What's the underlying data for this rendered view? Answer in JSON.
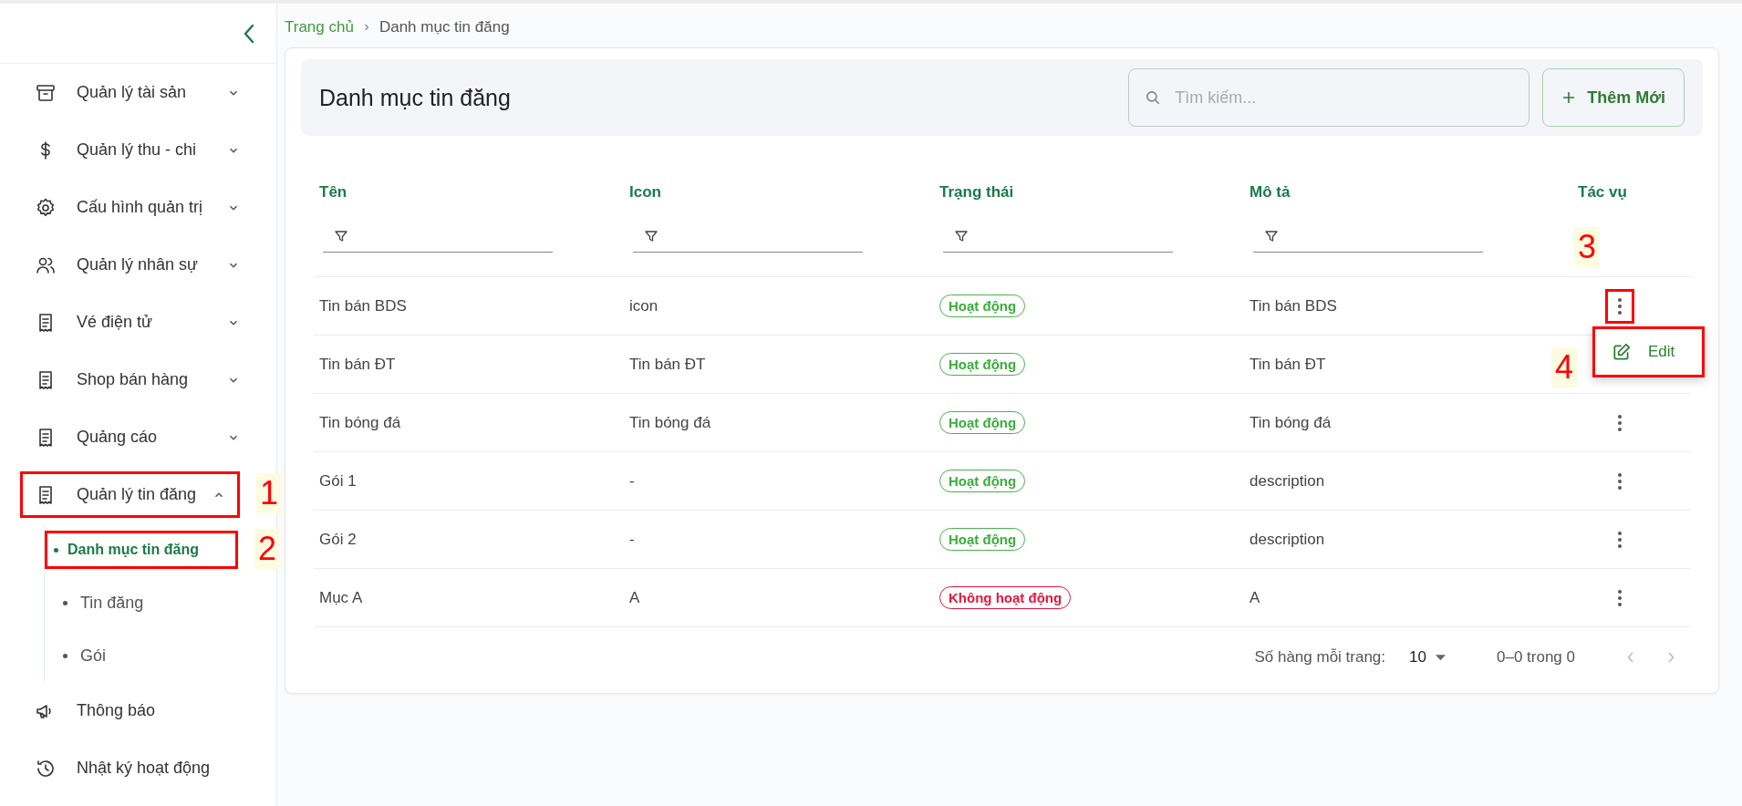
{
  "sidebar": {
    "items": [
      {
        "label": "Quản lý tài sản",
        "expanded": false
      },
      {
        "label": "Quản lý thu - chi",
        "expanded": false
      },
      {
        "label": "Cấu hình quản trị",
        "expanded": false
      },
      {
        "label": "Quản lý nhân sự",
        "expanded": false
      },
      {
        "label": "Vé điện tử",
        "expanded": false
      },
      {
        "label": "Shop bán hàng",
        "expanded": false
      },
      {
        "label": "Quảng cáo",
        "expanded": false
      },
      {
        "label": "Quản lý tin đăng",
        "expanded": true,
        "annotation": "1",
        "children": [
          {
            "label": "Danh mục tin đăng",
            "selected": true,
            "annotation": "2"
          },
          {
            "label": "Tin đăng",
            "selected": false
          },
          {
            "label": "Gói",
            "selected": false
          }
        ]
      },
      {
        "label": "Thông báo"
      },
      {
        "label": "Nhật ký hoạt động"
      }
    ]
  },
  "breadcrumb": [
    "Trang chủ",
    "Danh mục tin đăng"
  ],
  "page_title": "Danh mục tin đăng",
  "search": {
    "placeholder": "Tìm kiếm..."
  },
  "add_button": "Thêm Mới",
  "table": {
    "columns": [
      {
        "label": "Tên",
        "filter": true
      },
      {
        "label": "Icon",
        "filter": true
      },
      {
        "label": "Trạng thái",
        "filter": true
      },
      {
        "label": "Mô tả",
        "filter": true
      },
      {
        "label": "Tác vụ",
        "filter": false,
        "annotation": "3"
      }
    ],
    "rows": [
      {
        "name": "Tin bán BDS",
        "icon": "icon",
        "status": {
          "label": "Hoạt động",
          "active": true
        },
        "description": "Tin bán BDS",
        "menu_open": true
      },
      {
        "name": "Tin bán ĐT",
        "icon": "Tin bán ĐT",
        "status": {
          "label": "Hoạt động",
          "active": true
        },
        "description": "Tin bán ĐT",
        "menu_open": false
      },
      {
        "name": "Tin bóng đá",
        "icon": "Tin bóng đá",
        "status": {
          "label": "Hoạt động",
          "active": true
        },
        "description": "Tin bóng đá",
        "menu_open": false
      },
      {
        "name": "Gói 1",
        "icon": "-",
        "status": {
          "label": "Hoạt động",
          "active": true
        },
        "description": "description",
        "menu_open": false
      },
      {
        "name": "Gói 2",
        "icon": "-",
        "status": {
          "label": "Hoạt động",
          "active": true
        },
        "description": "description",
        "menu_open": false
      },
      {
        "name": "Mục A",
        "icon": "A",
        "status": {
          "label": "Không hoạt động",
          "active": false
        },
        "description": "A",
        "menu_open": false
      }
    ]
  },
  "row_menu": {
    "label": "Edit",
    "annotation": "4"
  },
  "pagination": {
    "rows_label": "Số hàng mỗi trang:",
    "rows_per_page": "10",
    "range": "0–0 trong 0"
  }
}
